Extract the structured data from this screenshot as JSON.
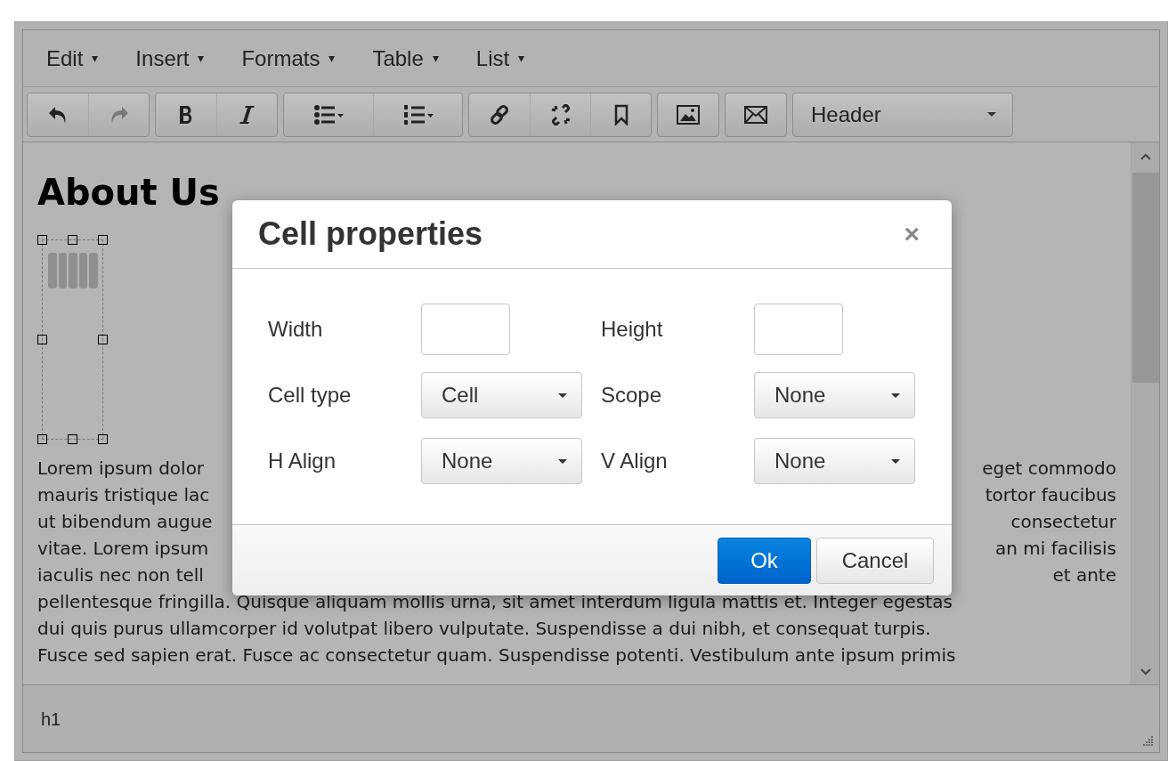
{
  "menubar": [
    {
      "label": "Edit",
      "caret": "▾"
    },
    {
      "label": "Insert",
      "caret": "▾"
    },
    {
      "label": "Formats",
      "caret": "▾"
    },
    {
      "label": "Table",
      "caret": "▾"
    },
    {
      "label": "List",
      "caret": "▾"
    }
  ],
  "toolbar": [
    {
      "buttons": [
        {
          "kind": "undo",
          "disabled": false
        },
        {
          "kind": "redo",
          "disabled": true
        }
      ]
    },
    {
      "buttons": [
        {
          "kind": "bold",
          "disabled": false
        },
        {
          "kind": "italic",
          "disabled": false
        }
      ]
    },
    {
      "buttons": [
        {
          "kind": "bullist",
          "disabled": false
        },
        {
          "kind": "numlist",
          "disabled": false
        }
      ]
    },
    {
      "buttons": [
        {
          "kind": "link",
          "disabled": false
        },
        {
          "kind": "unlink",
          "disabled": false
        },
        {
          "kind": "bookmark",
          "disabled": false
        }
      ]
    },
    {
      "buttons": [
        {
          "kind": "image",
          "disabled": false
        }
      ]
    },
    {
      "buttons": [
        {
          "kind": "email",
          "disabled": false
        }
      ]
    }
  ],
  "format_select": {
    "value": "Header"
  },
  "document": {
    "heading": "About Us",
    "image": {
      "selected": true
    },
    "lines": [
      {
        "left": "Lorem ipsum dolor",
        "right": "eget commodo"
      },
      {
        "left": "mauris tristique lac",
        "right": "tortor faucibus"
      },
      {
        "left": "ut bibendum augue",
        "right": "consectetur"
      },
      {
        "left": "vitae. Lorem ipsum",
        "right": "an mi facilisis"
      },
      {
        "left": "iaculis nec non tell",
        "right": "et ante"
      },
      {
        "text": "pellentesque fringilla. Quisque aliquam mollis urna, sit amet interdum ligula mattis et. Integer egestas"
      },
      {
        "text": "dui quis purus ullamcorper id volutpat libero vulputate. Suspendisse a dui nibh, et consequat turpis."
      },
      {
        "text": "Fusce sed sapien erat. Fusce ac consectetur quam. Suspendisse potenti. Vestibulum ante ipsum primis"
      }
    ]
  },
  "status_bar": {
    "path": "h1"
  },
  "dialog": {
    "title": "Cell properties",
    "close": "×",
    "fields": [
      {
        "label": "Width",
        "kind": "text"
      },
      {
        "label": "Height",
        "kind": "text"
      },
      {
        "label": "Cell type",
        "kind": "select",
        "value": "Cell"
      },
      {
        "label": "Scope",
        "kind": "select",
        "value": "None"
      },
      {
        "label": "H Align",
        "kind": "select",
        "value": "None"
      },
      {
        "label": "V Align",
        "kind": "select",
        "value": "None"
      }
    ],
    "buttons": [
      {
        "label": "Ok",
        "primary": true
      },
      {
        "label": "Cancel",
        "primary": false
      }
    ]
  }
}
